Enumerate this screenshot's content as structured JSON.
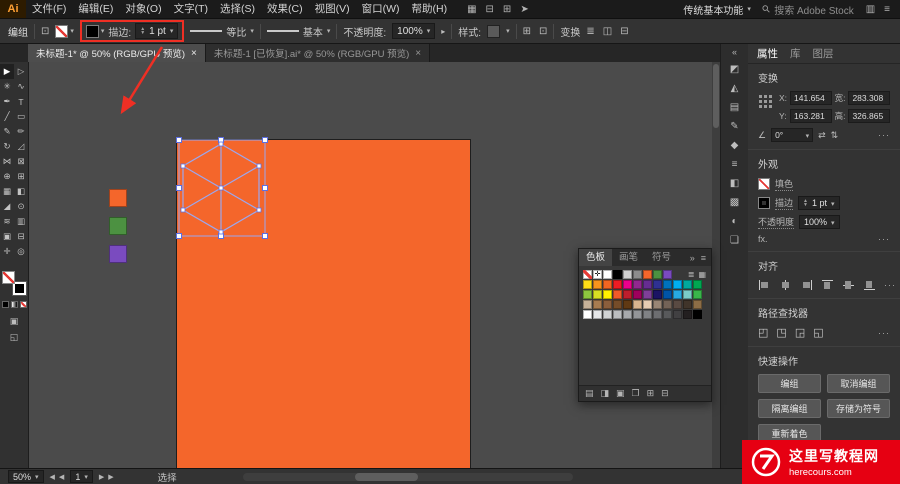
{
  "colors": {
    "artboard_orange": "#f4662b",
    "annotation_red": "#ef2f24",
    "selection_blue": "#9aa7f0",
    "watermark_red": "#e60012"
  },
  "menubar": {
    "logo": "Ai",
    "menus": [
      {
        "name": "file-menu",
        "label": "文件(F)"
      },
      {
        "name": "edit-menu",
        "label": "编辑(E)"
      },
      {
        "name": "object-menu",
        "label": "对象(O)"
      },
      {
        "name": "type-menu",
        "label": "文字(T)"
      },
      {
        "name": "select-menu",
        "label": "选择(S)"
      },
      {
        "name": "effect-menu",
        "label": "效果(C)"
      },
      {
        "name": "view-menu",
        "label": "视图(V)"
      },
      {
        "name": "window-menu",
        "label": "窗口(W)"
      },
      {
        "name": "help-menu",
        "label": "帮助(H)"
      }
    ],
    "left_icons": [
      {
        "name": "bridge-icon",
        "glyph": "▦"
      },
      {
        "name": "arrange-documents-icon",
        "glyph": "⊟"
      },
      {
        "name": "screen-mode-icon",
        "glyph": "⊞"
      },
      {
        "name": "gpu-performance-icon",
        "glyph": "➤"
      }
    ],
    "workspace": "传统基本功能",
    "search_label": "搜索 Adobe Stock",
    "right_icons": [
      {
        "name": "collapse-panels-icon",
        "glyph": "▥"
      },
      {
        "name": "app-menu-icon",
        "glyph": "≡"
      }
    ]
  },
  "controlbar": {
    "selection_type": "编组",
    "anchor_icon": "⊡",
    "stroke_label": "描边:",
    "stroke_value": "1 pt",
    "profile_label": "等比",
    "brush_label": "基本",
    "opacity_label": "不透明度:",
    "opacity_value": "100%",
    "style_label": "样式:",
    "transform_label": "变换",
    "mid_icons": [
      {
        "name": "document-setup-icon",
        "glyph": "⊞"
      },
      {
        "name": "preferences-icon",
        "glyph": "⊡"
      }
    ],
    "end_icons": [
      {
        "name": "align-objects-icon",
        "glyph": "≣"
      },
      {
        "name": "distribute-objects-icon",
        "glyph": "◫"
      },
      {
        "name": "isolate-selected-icon",
        "glyph": "⊟"
      }
    ]
  },
  "document_tabs": [
    {
      "name": "tab-untitled-1",
      "title": "未标题-1* @ 50% (RGB/GPU 预览)",
      "active": true
    },
    {
      "name": "tab-untitled-1-recovered",
      "title": "未标题-1 [已恢复].ai* @ 50% (RGB/GPU 预览)",
      "active": false
    }
  ],
  "toolbar_tools": [
    {
      "name": "selection-tool",
      "glyph": "▶"
    },
    {
      "name": "direct-selection-tool",
      "glyph": "▷"
    },
    {
      "name": "magic-wand-tool",
      "glyph": "✳"
    },
    {
      "name": "lasso-tool",
      "glyph": "∿"
    },
    {
      "name": "pen-tool",
      "glyph": "✒"
    },
    {
      "name": "type-tool",
      "glyph": "T"
    },
    {
      "name": "line-segment-tool",
      "glyph": "╱"
    },
    {
      "name": "rectangle-tool",
      "glyph": "▭"
    },
    {
      "name": "paintbrush-tool",
      "glyph": "✎"
    },
    {
      "name": "pencil-tool",
      "glyph": "✏"
    },
    {
      "name": "rotate-tool",
      "glyph": "↻"
    },
    {
      "name": "scale-tool",
      "glyph": "◿"
    },
    {
      "name": "width-tool",
      "glyph": "⋈"
    },
    {
      "name": "free-transform-tool",
      "glyph": "⊠"
    },
    {
      "name": "shape-builder-tool",
      "glyph": "⊕"
    },
    {
      "name": "perspective-grid-tool",
      "glyph": "⊞"
    },
    {
      "name": "mesh-tool",
      "glyph": "▦"
    },
    {
      "name": "gradient-tool",
      "glyph": "◧"
    },
    {
      "name": "eyedropper-tool",
      "glyph": "◢"
    },
    {
      "name": "blend-tool",
      "glyph": "⊙"
    },
    {
      "name": "symbol-sprayer-tool",
      "glyph": "≋"
    },
    {
      "name": "column-graph-tool",
      "glyph": "▥"
    },
    {
      "name": "artboard-tool",
      "glyph": "▣"
    },
    {
      "name": "slice-tool",
      "glyph": "⊟"
    },
    {
      "name": "hand-tool",
      "glyph": "✛"
    },
    {
      "name": "zoom-tool",
      "glyph": "◎"
    }
  ],
  "canvas": {
    "color_chips": [
      "#f4662b",
      "#4c9141",
      "#7a4bbf"
    ]
  },
  "dock_icons": [
    {
      "name": "color-panel-icon",
      "glyph": "◩"
    },
    {
      "name": "color-guide-panel-icon",
      "glyph": "◭"
    },
    {
      "name": "swatches-panel-icon",
      "glyph": "▤"
    },
    {
      "name": "brushes-panel-icon",
      "glyph": "✎"
    },
    {
      "name": "symbols-panel-icon",
      "glyph": "◆"
    },
    {
      "name": "stroke-panel-icon",
      "glyph": "≡"
    },
    {
      "name": "gradient-panel-icon",
      "glyph": "◧"
    },
    {
      "name": "transparency-panel-icon",
      "glyph": "▩"
    },
    {
      "name": "appearance-panel-icon",
      "glyph": "◐"
    },
    {
      "name": "layers-panel-icon",
      "glyph": "❏"
    }
  ],
  "swatches_panel": {
    "tabs": [
      {
        "name": "tab-swatches",
        "label": "色板",
        "active": true
      },
      {
        "name": "tab-brushes",
        "label": "画笔",
        "active": false
      },
      {
        "name": "tab-symbols",
        "label": "符号",
        "active": false
      }
    ],
    "header_icons": [
      {
        "name": "panel-expand-icon",
        "glyph": "»"
      },
      {
        "name": "panel-menu-icon",
        "glyph": "≡"
      }
    ],
    "view_icons": [
      {
        "name": "list-view-icon",
        "glyph": "≣"
      },
      {
        "name": "grid-view-icon",
        "glyph": "▦"
      }
    ],
    "rows": [
      [
        "none",
        "reg",
        "#ffffff",
        "#000000",
        "#d0d0d0",
        "#8c8c8c",
        "#f4662b",
        "#4c9141",
        "#7a4bbf"
      ],
      [
        "#ffde17",
        "#f7941d",
        "#f26522",
        "#ed1c24",
        "#ec008c",
        "#92278f",
        "#662d91",
        "#2e3192",
        "#0072bc",
        "#00aeef",
        "#00a99d",
        "#00a651"
      ],
      [
        "#8dc63f",
        "#d7df23",
        "#fff200",
        "#f15a29",
        "#be1e2d",
        "#9e005d",
        "#7f3f98",
        "#1b1464",
        "#0054a6",
        "#27aae1",
        "#7accc8",
        "#39b54a"
      ],
      [
        "#c7b299",
        "#a97c50",
        "#8b5e3c",
        "#754c29",
        "#603913",
        "#d9b48f",
        "#e6ccb3",
        "#998675",
        "#736357",
        "#594a42",
        "#40342a",
        "#8c6d46"
      ],
      [
        "#ffffff",
        "#e6e7e8",
        "#d1d3d4",
        "#bcbec0",
        "#a7a9ac",
        "#939598",
        "#808285",
        "#6d6e71",
        "#58595b",
        "#414042",
        "#231f20",
        "#000000"
      ]
    ],
    "footer_icons": [
      {
        "name": "swatch-libraries-icon",
        "glyph": "▤"
      },
      {
        "name": "swatch-kinds-icon",
        "glyph": "◨"
      },
      {
        "name": "swatch-options-icon",
        "glyph": "▣"
      },
      {
        "name": "new-color-group-icon",
        "glyph": "❐"
      },
      {
        "name": "new-swatch-icon",
        "glyph": "⊞"
      },
      {
        "name": "delete-swatch-icon",
        "glyph": "⊟"
      }
    ]
  },
  "properties": {
    "tabs": [
      {
        "name": "tab-properties",
        "label": "属性",
        "active": true
      },
      {
        "name": "tab-libraries",
        "label": "库",
        "active": false
      },
      {
        "name": "tab-layers",
        "label": "图层",
        "active": false
      }
    ],
    "panel_menu_icon": "≣",
    "transform": {
      "title": "变换",
      "x_label": "X:",
      "x_value": "141.654",
      "y_label": "Y:",
      "y_value": "163.281",
      "w_label": "宽:",
      "w_value": "283.308",
      "h_label": "高:",
      "h_value": "326.865",
      "angle_icon": "∠",
      "angle_value": "0°",
      "flip_h_icon": "⇄",
      "flip_v_icon": "⇅",
      "more": "···"
    },
    "appearance": {
      "title": "外观",
      "fill_label": "填色",
      "stroke_label": "描边",
      "stroke_value": "1 pt",
      "opacity_label": "不透明度",
      "opacity_value": "100%",
      "fx_label": "fx.",
      "more": "···"
    },
    "align": {
      "title": "对齐",
      "icons": [
        {
          "name": "align-left-icon",
          "cls": "al-l"
        },
        {
          "name": "align-center-icon",
          "cls": "al-c"
        },
        {
          "name": "align-right-icon",
          "cls": "al-r"
        },
        {
          "name": "align-top-icon",
          "cls": "al-t"
        },
        {
          "name": "align-middle-icon",
          "cls": "al-m"
        },
        {
          "name": "align-bottom-icon",
          "cls": "al-b"
        }
      ],
      "more": "···"
    },
    "pathfinder": {
      "title": "路径查找器",
      "icons": [
        {
          "name": "unite-icon",
          "glyph": "◰"
        },
        {
          "name": "minus-front-icon",
          "glyph": "◳"
        },
        {
          "name": "intersect-icon",
          "glyph": "◲"
        },
        {
          "name": "exclude-icon",
          "glyph": "◱"
        }
      ],
      "more": "···"
    },
    "quick_actions": {
      "title": "快速操作",
      "buttons": [
        {
          "name": "group-button",
          "label": "编组"
        },
        {
          "name": "ungroup-button",
          "label": "取消编组"
        },
        {
          "name": "isolate-group-button",
          "label": "隔离编组"
        },
        {
          "name": "save-as-symbol-button",
          "label": "存储为符号"
        },
        {
          "name": "recolor-button",
          "label": "重新着色"
        }
      ]
    }
  },
  "statusbar": {
    "zoom": "50%",
    "nav_prev_icons": [
      {
        "name": "first-artboard-icon",
        "glyph": "◀"
      },
      {
        "name": "prev-artboard-icon",
        "glyph": "◀"
      }
    ],
    "artboard_number": "1",
    "nav_next_icons": [
      {
        "name": "next-artboard-icon",
        "glyph": "▶"
      },
      {
        "name": "last-artboard-icon",
        "glyph": "▶"
      }
    ],
    "tool_hint": "选择"
  },
  "watermark": {
    "title": "这里写教程网",
    "domain": "herecours.com"
  }
}
